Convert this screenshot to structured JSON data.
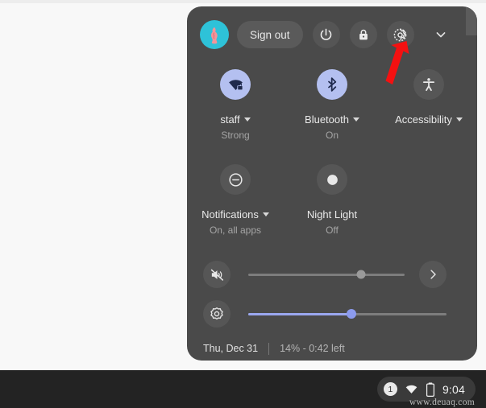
{
  "panel": {
    "name": "quick-settings",
    "background_color": "#4a4a4a",
    "top_row": {
      "avatar_label": "user-avatar",
      "avatar_color": "#2ec2d8",
      "sign_out_label": "Sign out",
      "power_label": "power-icon",
      "lock_label": "lock-icon",
      "settings_label": "settings-gear-icon",
      "collapse_label": "chevron-down-icon"
    },
    "tiles": [
      {
        "id": "network",
        "label": "staff",
        "sub": "Strong",
        "state": "on",
        "icon": "wifi-locked-icon",
        "has_caret": true
      },
      {
        "id": "bluetooth",
        "label": "Bluetooth",
        "sub": "On",
        "state": "on",
        "icon": "bluetooth-icon",
        "has_caret": true
      },
      {
        "id": "accessibility",
        "label": "Accessibility",
        "sub": "",
        "state": "off",
        "icon": "accessibility-icon",
        "has_caret": true
      },
      {
        "id": "notifications",
        "label": "Notifications",
        "sub": "On, all apps",
        "state": "off",
        "icon": "do-not-disturb-icon",
        "has_caret": true
      },
      {
        "id": "night-light",
        "label": "Night Light",
        "sub": "Off",
        "state": "off",
        "icon": "moon-icon",
        "has_caret": false
      }
    ],
    "sliders": [
      {
        "id": "volume",
        "icon": "volume-muted-icon",
        "value": 72,
        "muted": true,
        "fill_color": "#7d7d7d"
      },
      {
        "id": "brightness",
        "icon": "brightness-icon",
        "value": 52,
        "muted": false,
        "fill_color": "#9aa7ef"
      }
    ],
    "audio_settings_label": "chevron-right-icon",
    "footer": {
      "date": "Thu, Dec 31",
      "battery": "14% - 0:42 left"
    }
  },
  "shelf": {
    "notification_count": "1",
    "wifi_label": "wifi-icon",
    "battery_label": "battery-icon",
    "time": "9:04"
  },
  "watermark": {
    "text": "www.deuaq.com"
  },
  "annotation": {
    "arrow_color": "#f41111",
    "points_at": "settings-gear-icon"
  }
}
